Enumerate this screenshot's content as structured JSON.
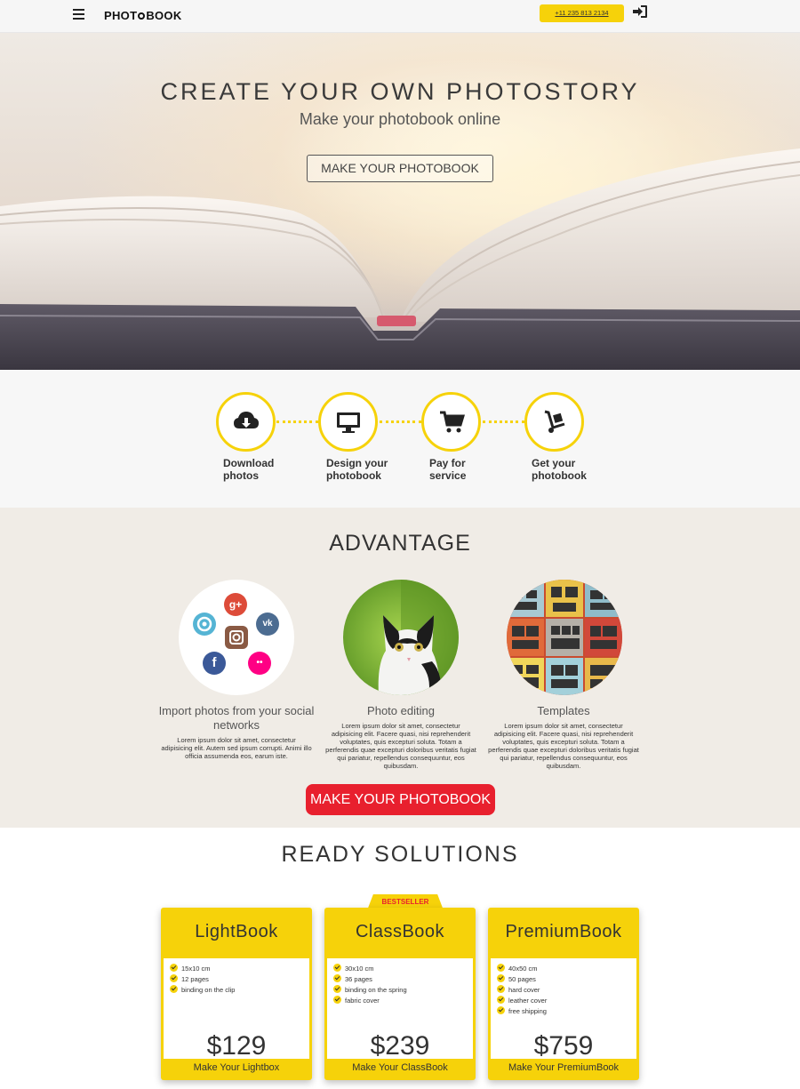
{
  "header": {
    "menu_icon": "hamburger-icon",
    "logo_text": "PHOTOBOOK",
    "phone": "+11 235 813 2134",
    "login_icon": "sign-in-icon"
  },
  "hero": {
    "title": "CREATE YOUR OWN PHOTOSTORY",
    "subtitle": "Make your photobook online",
    "cta": "MAKE YOUR PHOTOBOOK"
  },
  "steps": [
    {
      "icon": "cloud-download-icon",
      "line1": "Download",
      "line2": "photos"
    },
    {
      "icon": "monitor-icon",
      "line1": "Design your",
      "line2": "photobook"
    },
    {
      "icon": "shopping-cart-icon",
      "line1": "Pay for",
      "line2": "service"
    },
    {
      "icon": "hand-truck-icon",
      "line1": "Get your",
      "line2": "photobook"
    }
  ],
  "advantage": {
    "title": "ADVANTAGE",
    "items": [
      {
        "heading": "Import photos from your social networks",
        "text": "Lorem ipsum dolor sit amet, consectetur adipisicing elit. Autem sed ipsum corrupti. Animi illo officia assumenda eos, earum iste."
      },
      {
        "heading": "Photo editing",
        "text": "Lorem ipsum dolor sit amet, consectetur adipisicing elit. Facere quasi, nisi reprehenderit voluptates, quis excepturi soluta. Totam a perferendis quae excepturi doloribus veritatis fugiat qui pariatur, repellendus consequuntur, eos quibusdam."
      },
      {
        "heading": "Templates",
        "text": "Lorem ipsum dolor sit amet, consectetur adipisicing elit. Facere quasi, nisi reprehenderit voluptates, quis excepturi soluta. Totam a perferendis quae excepturi doloribus veritatis fugiat qui pariatur, repellendus consequuntur, eos quibusdam."
      }
    ],
    "social_icons": {
      "google_plus": "g+",
      "vk": "vk",
      "flickr": "••",
      "facebook": "f"
    },
    "cta": "MAKE YOUR PHOTOBOOK"
  },
  "ready": {
    "title": "READY SOLUTIONS",
    "badge": "BESTSELLER",
    "cards": [
      {
        "name": "LightBook",
        "features": [
          "15x10 cm",
          "12 pages",
          "binding on the clip"
        ],
        "price": "$129",
        "button": "Make Your Lightbox"
      },
      {
        "name": "ClassBook",
        "features": [
          "30x10 cm",
          "36 pages",
          "binding on the spring",
          "fabric cover"
        ],
        "price": "$239",
        "button": "Make Your ClassBook"
      },
      {
        "name": "PremiumBook",
        "features": [
          "40x50 cm",
          "50 pages",
          "hard cover",
          "leather cover",
          "free shipping"
        ],
        "price": "$759",
        "button": "Make Your PremiumBook"
      }
    ]
  },
  "colors": {
    "accent_yellow": "#f6d20a",
    "cta_red": "#e8202e",
    "advantage_bg": "#f0ece6"
  }
}
